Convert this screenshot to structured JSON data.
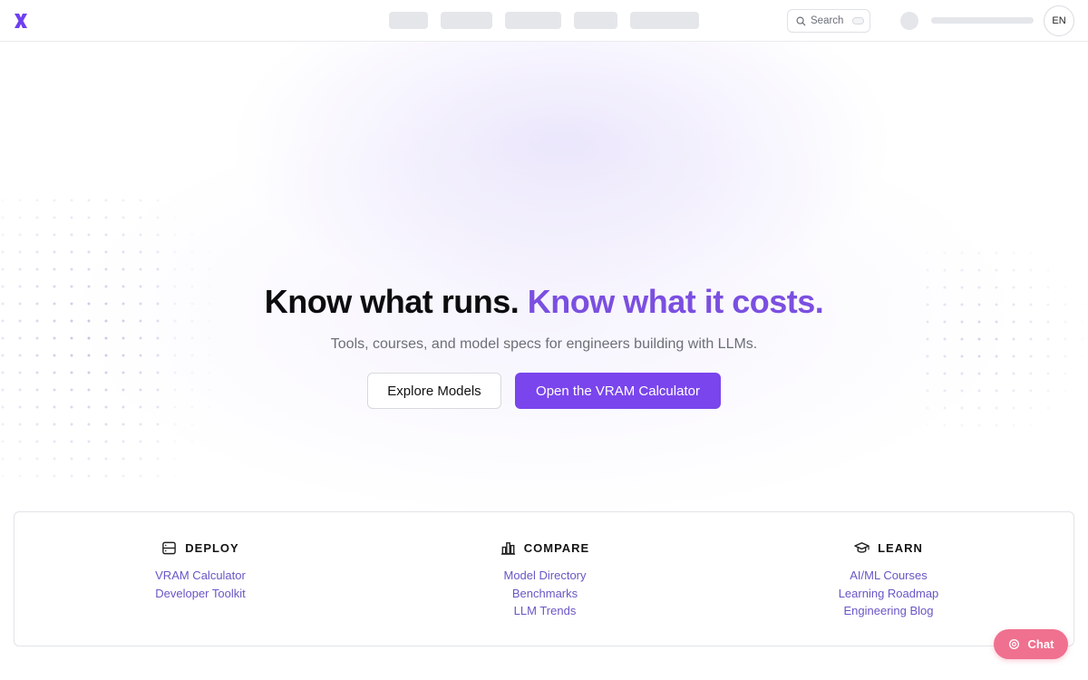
{
  "header": {
    "search_label": "Search",
    "lang": "EN",
    "brand_color": "#7b4fe0"
  },
  "hero": {
    "title_main": "Know what runs.",
    "title_accent": "Know what it costs.",
    "subtitle": "Tools, courses, and model specs for engineers building with LLMs.",
    "btn_secondary": "Explore Models",
    "btn_primary": "Open the VRAM Calculator",
    "accent_color": "#7b4fe0",
    "primary_button_color": "#7a45ec"
  },
  "sections": [
    {
      "title": "DEPLOY",
      "icon": "server-icon",
      "links": [
        "VRAM Calculator",
        "Developer Toolkit"
      ]
    },
    {
      "title": "COMPARE",
      "icon": "bar-chart-icon",
      "links": [
        "Model Directory",
        "Benchmarks",
        "LLM Trends"
      ]
    },
    {
      "title": "LEARN",
      "icon": "graduation-cap-icon",
      "links": [
        "AI/ML Courses",
        "Learning Roadmap",
        "Engineering Blog"
      ]
    }
  ],
  "chat": {
    "label": "Chat",
    "color": "#f0708f"
  }
}
